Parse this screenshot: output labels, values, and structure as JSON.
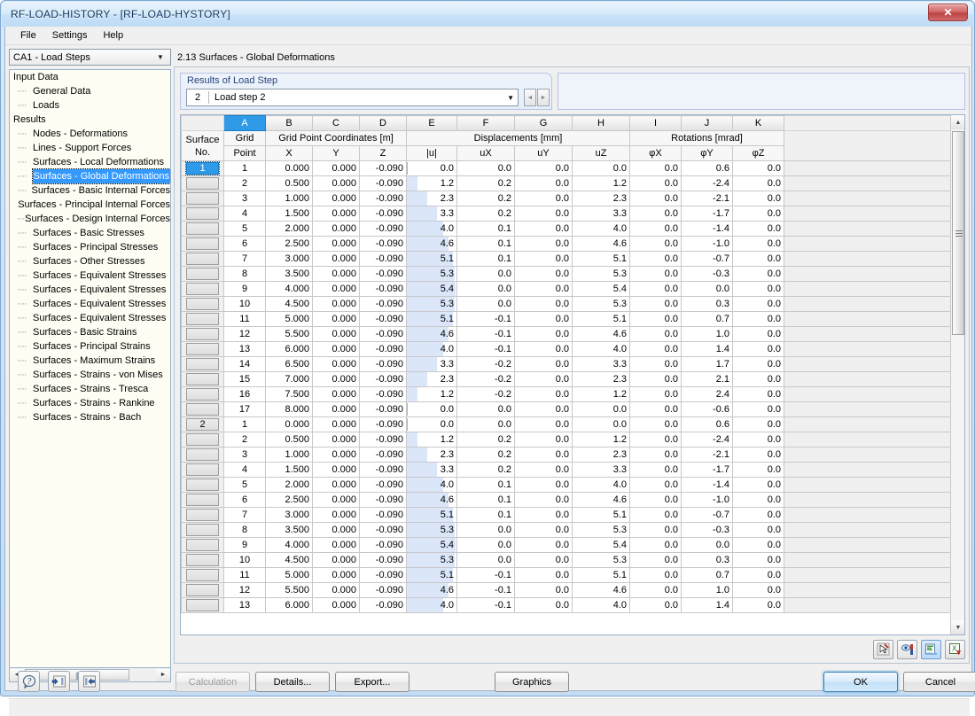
{
  "window": {
    "title": "RF-LOAD-HISTORY - [RF-LOAD-HYSTORY]",
    "close_label": "✕"
  },
  "menubar": {
    "items": [
      {
        "label": "File"
      },
      {
        "label": "Settings"
      },
      {
        "label": "Help"
      }
    ]
  },
  "sidebar": {
    "combo": {
      "value": "CA1 - Load Steps",
      "arrow": "▼"
    },
    "tree": [
      {
        "label": "Input Data",
        "level": 0,
        "selected": false
      },
      {
        "label": "General Data",
        "level": 1,
        "selected": false
      },
      {
        "label": "Loads",
        "level": 1,
        "selected": false
      },
      {
        "label": "Results",
        "level": 0,
        "selected": false
      },
      {
        "label": "Nodes - Deformations",
        "level": 1,
        "selected": false
      },
      {
        "label": "Lines - Support Forces",
        "level": 1,
        "selected": false
      },
      {
        "label": "Surfaces - Local Deformations",
        "level": 1,
        "selected": false
      },
      {
        "label": "Surfaces - Global Deformations",
        "level": 1,
        "selected": true
      },
      {
        "label": "Surfaces - Basic Internal Forces",
        "level": 1,
        "selected": false
      },
      {
        "label": "Surfaces - Principal Internal Forces",
        "level": 1,
        "selected": false
      },
      {
        "label": "Surfaces - Design Internal Forces",
        "level": 1,
        "selected": false
      },
      {
        "label": "Surfaces - Basic Stresses",
        "level": 1,
        "selected": false
      },
      {
        "label": "Surfaces - Principal Stresses",
        "level": 1,
        "selected": false
      },
      {
        "label": "Surfaces - Other Stresses",
        "level": 1,
        "selected": false
      },
      {
        "label": "Surfaces - Equivalent Stresses",
        "level": 1,
        "selected": false
      },
      {
        "label": "Surfaces - Equivalent Stresses",
        "level": 1,
        "selected": false
      },
      {
        "label": "Surfaces - Equivalent Stresses",
        "level": 1,
        "selected": false
      },
      {
        "label": "Surfaces - Equivalent Stresses",
        "level": 1,
        "selected": false
      },
      {
        "label": "Surfaces - Basic Strains",
        "level": 1,
        "selected": false
      },
      {
        "label": "Surfaces - Principal Strains",
        "level": 1,
        "selected": false
      },
      {
        "label": "Surfaces - Maximum Strains",
        "level": 1,
        "selected": false
      },
      {
        "label": "Surfaces - Strains - von Mises",
        "level": 1,
        "selected": false
      },
      {
        "label": "Surfaces - Strains - Tresca",
        "level": 1,
        "selected": false
      },
      {
        "label": "Surfaces - Strains - Rankine",
        "level": 1,
        "selected": false
      },
      {
        "label": "Surfaces - Strains - Bach",
        "level": 1,
        "selected": false
      }
    ],
    "hscroll": {
      "left_arrow": "◄",
      "right_arrow": "►",
      "thumb_grip": "|||"
    }
  },
  "main": {
    "section_title": "2.13 Surfaces - Global Deformations",
    "loadstep": {
      "caption": "Results of Load Step",
      "number": "2",
      "text": "Load step 2",
      "arrow": "▼",
      "prev": "◄",
      "next": "►"
    }
  },
  "table": {
    "column_letters": [
      "",
      "A",
      "B",
      "C",
      "D",
      "E",
      "F",
      "G",
      "H",
      "I",
      "J",
      "K",
      ""
    ],
    "corner_line1": "Surface",
    "corner_line2": "No.",
    "groups": [
      {
        "label": "Grid",
        "sub": "Point"
      },
      {
        "label": "Grid Point Coordinates [m]",
        "subs": [
          "X",
          "Y",
          "Z"
        ]
      },
      {
        "label": "Displacements [mm]",
        "subs": [
          "|u|",
          "uX",
          "uY",
          "uZ"
        ]
      },
      {
        "label": "Rotations [mrad]",
        "subs": [
          "φX",
          "φY",
          "φZ"
        ]
      }
    ],
    "bar_max": 5.4,
    "rows": [
      {
        "surface": "1",
        "selected": true,
        "point": "1",
        "x": "0.000",
        "y": "0.000",
        "z": "-0.090",
        "u": "0.0",
        "ubar": 0.0,
        "ux": "0.0",
        "uy": "0.0",
        "uz": "0.0",
        "px": "0.0",
        "py": "0.6",
        "pz": "0.0"
      },
      {
        "surface": "",
        "selected": false,
        "point": "2",
        "x": "0.500",
        "y": "0.000",
        "z": "-0.090",
        "u": "1.2",
        "ubar": 1.2,
        "ux": "0.2",
        "uy": "0.0",
        "uz": "1.2",
        "px": "0.0",
        "py": "-2.4",
        "pz": "0.0"
      },
      {
        "surface": "",
        "selected": false,
        "point": "3",
        "x": "1.000",
        "y": "0.000",
        "z": "-0.090",
        "u": "2.3",
        "ubar": 2.3,
        "ux": "0.2",
        "uy": "0.0",
        "uz": "2.3",
        "px": "0.0",
        "py": "-2.1",
        "pz": "0.0"
      },
      {
        "surface": "",
        "selected": false,
        "point": "4",
        "x": "1.500",
        "y": "0.000",
        "z": "-0.090",
        "u": "3.3",
        "ubar": 3.3,
        "ux": "0.2",
        "uy": "0.0",
        "uz": "3.3",
        "px": "0.0",
        "py": "-1.7",
        "pz": "0.0"
      },
      {
        "surface": "",
        "selected": false,
        "point": "5",
        "x": "2.000",
        "y": "0.000",
        "z": "-0.090",
        "u": "4.0",
        "ubar": 4.0,
        "ux": "0.1",
        "uy": "0.0",
        "uz": "4.0",
        "px": "0.0",
        "py": "-1.4",
        "pz": "0.0"
      },
      {
        "surface": "",
        "selected": false,
        "point": "6",
        "x": "2.500",
        "y": "0.000",
        "z": "-0.090",
        "u": "4.6",
        "ubar": 4.6,
        "ux": "0.1",
        "uy": "0.0",
        "uz": "4.6",
        "px": "0.0",
        "py": "-1.0",
        "pz": "0.0"
      },
      {
        "surface": "",
        "selected": false,
        "point": "7",
        "x": "3.000",
        "y": "0.000",
        "z": "-0.090",
        "u": "5.1",
        "ubar": 5.1,
        "ux": "0.1",
        "uy": "0.0",
        "uz": "5.1",
        "px": "0.0",
        "py": "-0.7",
        "pz": "0.0"
      },
      {
        "surface": "",
        "selected": false,
        "point": "8",
        "x": "3.500",
        "y": "0.000",
        "z": "-0.090",
        "u": "5.3",
        "ubar": 5.3,
        "ux": "0.0",
        "uy": "0.0",
        "uz": "5.3",
        "px": "0.0",
        "py": "-0.3",
        "pz": "0.0"
      },
      {
        "surface": "",
        "selected": false,
        "point": "9",
        "x": "4.000",
        "y": "0.000",
        "z": "-0.090",
        "u": "5.4",
        "ubar": 5.4,
        "ux": "0.0",
        "uy": "0.0",
        "uz": "5.4",
        "px": "0.0",
        "py": "0.0",
        "pz": "0.0"
      },
      {
        "surface": "",
        "selected": false,
        "point": "10",
        "x": "4.500",
        "y": "0.000",
        "z": "-0.090",
        "u": "5.3",
        "ubar": 5.3,
        "ux": "0.0",
        "uy": "0.0",
        "uz": "5.3",
        "px": "0.0",
        "py": "0.3",
        "pz": "0.0"
      },
      {
        "surface": "",
        "selected": false,
        "point": "11",
        "x": "5.000",
        "y": "0.000",
        "z": "-0.090",
        "u": "5.1",
        "ubar": 5.1,
        "ux": "-0.1",
        "uy": "0.0",
        "uz": "5.1",
        "px": "0.0",
        "py": "0.7",
        "pz": "0.0"
      },
      {
        "surface": "",
        "selected": false,
        "point": "12",
        "x": "5.500",
        "y": "0.000",
        "z": "-0.090",
        "u": "4.6",
        "ubar": 4.6,
        "ux": "-0.1",
        "uy": "0.0",
        "uz": "4.6",
        "px": "0.0",
        "py": "1.0",
        "pz": "0.0"
      },
      {
        "surface": "",
        "selected": false,
        "point": "13",
        "x": "6.000",
        "y": "0.000",
        "z": "-0.090",
        "u": "4.0",
        "ubar": 4.0,
        "ux": "-0.1",
        "uy": "0.0",
        "uz": "4.0",
        "px": "0.0",
        "py": "1.4",
        "pz": "0.0"
      },
      {
        "surface": "",
        "selected": false,
        "point": "14",
        "x": "6.500",
        "y": "0.000",
        "z": "-0.090",
        "u": "3.3",
        "ubar": 3.3,
        "ux": "-0.2",
        "uy": "0.0",
        "uz": "3.3",
        "px": "0.0",
        "py": "1.7",
        "pz": "0.0"
      },
      {
        "surface": "",
        "selected": false,
        "point": "15",
        "x": "7.000",
        "y": "0.000",
        "z": "-0.090",
        "u": "2.3",
        "ubar": 2.3,
        "ux": "-0.2",
        "uy": "0.0",
        "uz": "2.3",
        "px": "0.0",
        "py": "2.1",
        "pz": "0.0"
      },
      {
        "surface": "",
        "selected": false,
        "point": "16",
        "x": "7.500",
        "y": "0.000",
        "z": "-0.090",
        "u": "1.2",
        "ubar": 1.2,
        "ux": "-0.2",
        "uy": "0.0",
        "uz": "1.2",
        "px": "0.0",
        "py": "2.4",
        "pz": "0.0"
      },
      {
        "surface": "",
        "selected": false,
        "point": "17",
        "x": "8.000",
        "y": "0.000",
        "z": "-0.090",
        "u": "0.0",
        "ubar": 0.0,
        "ux": "0.0",
        "uy": "0.0",
        "uz": "0.0",
        "px": "0.0",
        "py": "-0.6",
        "pz": "0.0"
      },
      {
        "surface": "2",
        "selected": false,
        "point": "1",
        "x": "0.000",
        "y": "0.000",
        "z": "-0.090",
        "u": "0.0",
        "ubar": 0.0,
        "ux": "0.0",
        "uy": "0.0",
        "uz": "0.0",
        "px": "0.0",
        "py": "0.6",
        "pz": "0.0"
      },
      {
        "surface": "",
        "selected": false,
        "point": "2",
        "x": "0.500",
        "y": "0.000",
        "z": "-0.090",
        "u": "1.2",
        "ubar": 1.2,
        "ux": "0.2",
        "uy": "0.0",
        "uz": "1.2",
        "px": "0.0",
        "py": "-2.4",
        "pz": "0.0"
      },
      {
        "surface": "",
        "selected": false,
        "point": "3",
        "x": "1.000",
        "y": "0.000",
        "z": "-0.090",
        "u": "2.3",
        "ubar": 2.3,
        "ux": "0.2",
        "uy": "0.0",
        "uz": "2.3",
        "px": "0.0",
        "py": "-2.1",
        "pz": "0.0"
      },
      {
        "surface": "",
        "selected": false,
        "point": "4",
        "x": "1.500",
        "y": "0.000",
        "z": "-0.090",
        "u": "3.3",
        "ubar": 3.3,
        "ux": "0.2",
        "uy": "0.0",
        "uz": "3.3",
        "px": "0.0",
        "py": "-1.7",
        "pz": "0.0"
      },
      {
        "surface": "",
        "selected": false,
        "point": "5",
        "x": "2.000",
        "y": "0.000",
        "z": "-0.090",
        "u": "4.0",
        "ubar": 4.0,
        "ux": "0.1",
        "uy": "0.0",
        "uz": "4.0",
        "px": "0.0",
        "py": "-1.4",
        "pz": "0.0"
      },
      {
        "surface": "",
        "selected": false,
        "point": "6",
        "x": "2.500",
        "y": "0.000",
        "z": "-0.090",
        "u": "4.6",
        "ubar": 4.6,
        "ux": "0.1",
        "uy": "0.0",
        "uz": "4.6",
        "px": "0.0",
        "py": "-1.0",
        "pz": "0.0"
      },
      {
        "surface": "",
        "selected": false,
        "point": "7",
        "x": "3.000",
        "y": "0.000",
        "z": "-0.090",
        "u": "5.1",
        "ubar": 5.1,
        "ux": "0.1",
        "uy": "0.0",
        "uz": "5.1",
        "px": "0.0",
        "py": "-0.7",
        "pz": "0.0"
      },
      {
        "surface": "",
        "selected": false,
        "point": "8",
        "x": "3.500",
        "y": "0.000",
        "z": "-0.090",
        "u": "5.3",
        "ubar": 5.3,
        "ux": "0.0",
        "uy": "0.0",
        "uz": "5.3",
        "px": "0.0",
        "py": "-0.3",
        "pz": "0.0"
      },
      {
        "surface": "",
        "selected": false,
        "point": "9",
        "x": "4.000",
        "y": "0.000",
        "z": "-0.090",
        "u": "5.4",
        "ubar": 5.4,
        "ux": "0.0",
        "uy": "0.0",
        "uz": "5.4",
        "px": "0.0",
        "py": "0.0",
        "pz": "0.0"
      },
      {
        "surface": "",
        "selected": false,
        "point": "10",
        "x": "4.500",
        "y": "0.000",
        "z": "-0.090",
        "u": "5.3",
        "ubar": 5.3,
        "ux": "0.0",
        "uy": "0.0",
        "uz": "5.3",
        "px": "0.0",
        "py": "0.3",
        "pz": "0.0"
      },
      {
        "surface": "",
        "selected": false,
        "point": "11",
        "x": "5.000",
        "y": "0.000",
        "z": "-0.090",
        "u": "5.1",
        "ubar": 5.1,
        "ux": "-0.1",
        "uy": "0.0",
        "uz": "5.1",
        "px": "0.0",
        "py": "0.7",
        "pz": "0.0"
      },
      {
        "surface": "",
        "selected": false,
        "point": "12",
        "x": "5.500",
        "y": "0.000",
        "z": "-0.090",
        "u": "4.6",
        "ubar": 4.6,
        "ux": "-0.1",
        "uy": "0.0",
        "uz": "4.6",
        "px": "0.0",
        "py": "1.0",
        "pz": "0.0"
      },
      {
        "surface": "",
        "selected": false,
        "point": "13",
        "x": "6.000",
        "y": "0.000",
        "z": "-0.090",
        "u": "4.0",
        "ubar": 4.0,
        "ux": "-0.1",
        "uy": "0.0",
        "uz": "4.0",
        "px": "0.0",
        "py": "1.4",
        "pz": "0.0"
      }
    ],
    "scrollbar": {
      "up": "▲",
      "down": "▼"
    },
    "tools": [
      {
        "name": "select-in-graphic-icon",
        "active": false
      },
      {
        "name": "view-mode-icon",
        "active": false
      },
      {
        "name": "table-filter-icon",
        "active": true
      },
      {
        "name": "export-excel-icon",
        "active": false
      }
    ]
  },
  "bottombar": {
    "help_icon": "help-icon",
    "back_icon": "back-arrow-icon",
    "forward_icon": "forward-arrow-icon",
    "buttons": [
      {
        "label": "Calculation",
        "disabled": true,
        "name": "calculation-button"
      },
      {
        "label": "Details...",
        "disabled": false,
        "name": "details-button"
      },
      {
        "label": "Export...",
        "disabled": false,
        "name": "export-button"
      },
      {
        "label": "Graphics",
        "disabled": false,
        "name": "graphics-button"
      }
    ],
    "ok_label": "OK",
    "cancel_label": "Cancel"
  },
  "colors": {
    "accent": "#2f9ae8",
    "bar_fill": "#dce6f9",
    "title_text": "#12355b"
  }
}
